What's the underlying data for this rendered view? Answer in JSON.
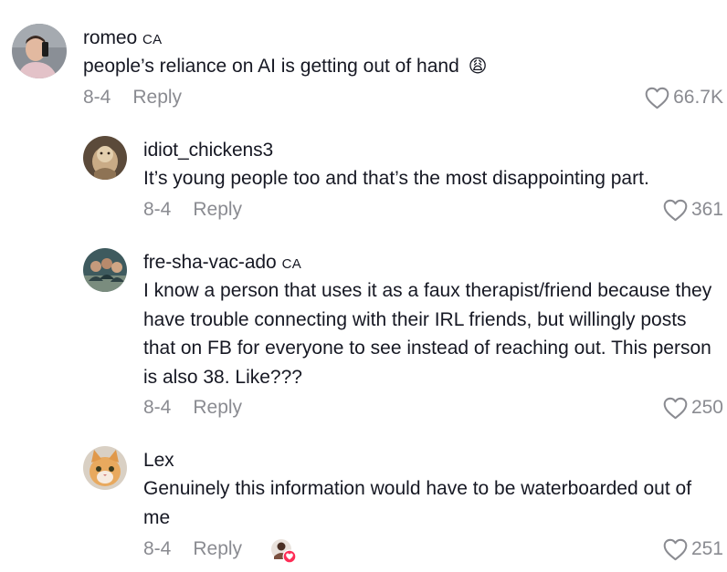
{
  "comments": [
    {
      "username": "romeo",
      "region": "CA",
      "text": "people’s reliance on AI is getting out of hand",
      "emoji": "😩",
      "date": "8-4",
      "reply_label": "Reply",
      "likes": "66.7K"
    },
    {
      "username": "idiot_chickens3",
      "region": "",
      "text": "It’s young people too and that’s the most disappointing part.",
      "date": "8-4",
      "reply_label": "Reply",
      "likes": "361"
    },
    {
      "username": "fre-sha-vac-ado",
      "region": "CA",
      "text": "I know a person that uses it as a faux therapist/friend because they have trouble connecting with their IRL friends, but willingly posts that on FB for everyone to see instead of reaching out. This person is also 38. Like???",
      "date": "8-4",
      "reply_label": "Reply",
      "likes": "250"
    },
    {
      "username": "Lex",
      "region": "",
      "text": "Genuinely this information would have to be waterboarded out of me",
      "date": "8-4",
      "reply_label": "Reply",
      "likes": "251"
    }
  ],
  "colors": {
    "text": "#161823",
    "muted": "#8a8b91",
    "like_badge": "#fe2c55"
  },
  "icons": {
    "like": "heart-outline-icon",
    "creator_liked_badge": "heart-badge-icon"
  }
}
